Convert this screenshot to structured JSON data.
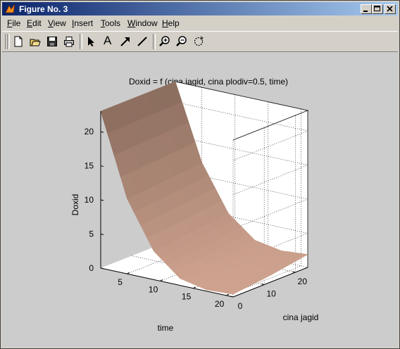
{
  "window": {
    "title": "Figure No. 3"
  },
  "menu": [
    {
      "key": "F",
      "rest": "ile"
    },
    {
      "key": "E",
      "rest": "dit"
    },
    {
      "key": "V",
      "rest": "iew"
    },
    {
      "key": "I",
      "rest": "nsert"
    },
    {
      "key": "T",
      "rest": "ools"
    },
    {
      "key": "W",
      "rest": "indow"
    },
    {
      "key": "H",
      "rest": "elp"
    }
  ],
  "toolbar": {
    "icons": [
      "new-file-icon",
      "open-icon",
      "save-icon",
      "print-icon",
      "arrow-select-icon",
      "text-a-icon",
      "arrow-icon",
      "line-icon",
      "zoom-in-icon",
      "zoom-out-icon",
      "rotate-icon"
    ],
    "text_tool_label": "A"
  },
  "plot": {
    "title": "Doxid = f (cina jagid, cina plodiv=0.5, time)",
    "zlabel": "Doxid",
    "xlabel": "time",
    "ylabel": "cina jagid",
    "surface_color": "#cfa38f"
  },
  "chart_data": {
    "type": "surface",
    "title": "Doxid = f (cina jagid, cina plodiv=0.5, time)",
    "xlabel": "time",
    "ylabel": "cina jagid",
    "zlabel": "Doxid",
    "x_ticks": [
      5,
      10,
      15,
      20
    ],
    "y_ticks": [
      0,
      10,
      20
    ],
    "z_ticks": [
      0,
      5,
      10,
      15,
      20
    ],
    "xlim": [
      1,
      21
    ],
    "ylim": [
      0,
      24
    ],
    "zlim": [
      0,
      23
    ],
    "grid": true,
    "surface": {
      "x": [
        1,
        5,
        9,
        13,
        17,
        21
      ],
      "y": [
        0,
        12,
        24
      ],
      "z": [
        [
          23.0,
          23.0,
          23.0
        ],
        [
          11.0,
          11.5,
          12.0
        ],
        [
          4.2,
          4.8,
          5.4
        ],
        [
          1.0,
          1.6,
          2.3
        ],
        [
          0.2,
          0.8,
          1.6
        ],
        [
          0.4,
          1.0,
          1.9
        ]
      ]
    }
  }
}
